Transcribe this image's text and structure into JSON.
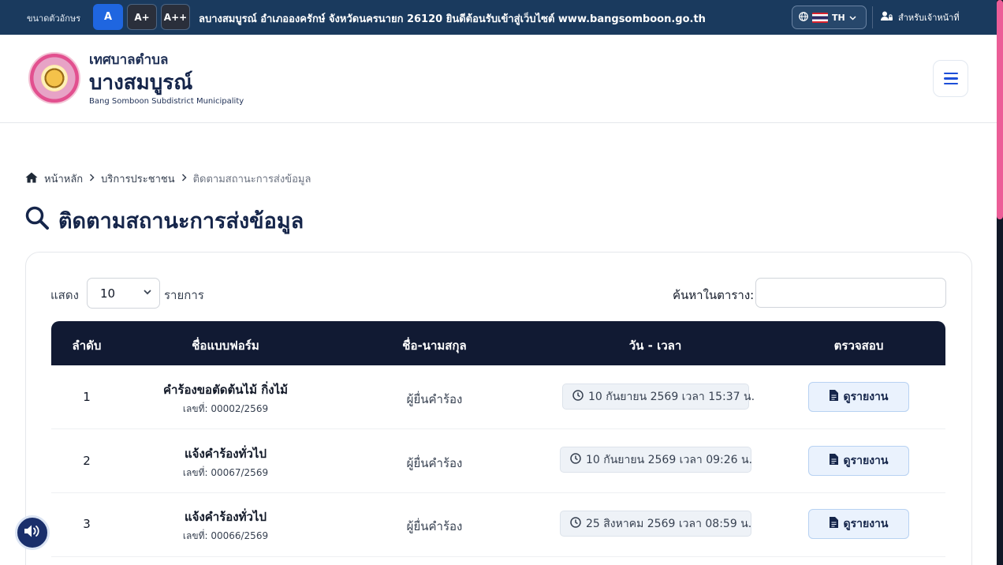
{
  "topbar": {
    "font_size_label": "ขนาดตัวอักษร",
    "font_buttons": [
      "A",
      "A+",
      "A++"
    ],
    "marquee": "ลบางสมบูรณ์ อำเภอองครักษ์ จังหวัดนครนายก 26120 ยินดีต้อนรับเข้าสู่เว็บไซต์ www.bangsomboon.go.th",
    "language": "TH",
    "staff_link": "สำหรับเจ้าหน้าที่"
  },
  "header": {
    "org_small": "เทศบาลตำบล",
    "org_big": "บางสมบูรณ์",
    "org_en": "Bang Somboon Subdistrict Municipality"
  },
  "breadcrumb": {
    "home": "หน้าหลัก",
    "section": "บริการประชาชน",
    "current": "ติดตามสถานะการส่งข้อมูล"
  },
  "page_title": "ติดตามสถานะการส่งข้อมูล",
  "table_controls": {
    "show_label": "แสดง",
    "page_size": "10",
    "items_label": "รายการ",
    "search_label": "ค้นหาในตาราง:",
    "search_value": ""
  },
  "table": {
    "headers": [
      "ลำดับ",
      "ชื่อแบบฟอร์ม",
      "ชื่อ-นามสกุล",
      "วัน - เวลา",
      "ตรวจสอบ"
    ],
    "rows": [
      {
        "no": "1",
        "form": "คำร้องขอตัดต้นไม้ กิ่งไม้",
        "ref": "เลขที่: 00002/2569",
        "name": "ผู้ยื่นคำร้อง",
        "datetime": "10 กันยายน 2569 เวลา 15:37 น.",
        "action": "ดูรายงาน"
      },
      {
        "no": "2",
        "form": "แจ้งคำร้องทั่วไป",
        "ref": "เลขที่: 00067/2569",
        "name": "ผู้ยื่นคำร้อง",
        "datetime": "10 กันยายน 2569 เวลา 09:26 น.",
        "action": "ดูรายงาน"
      },
      {
        "no": "3",
        "form": "แจ้งคำร้องทั่วไป",
        "ref": "เลขที่: 00066/2569",
        "name": "ผู้ยื่นคำร้อง",
        "datetime": "25 สิงหาคม 2569 เวลา 08:59 น.",
        "action": "ดูรายงาน"
      }
    ]
  },
  "colors": {
    "topbar": "#1a3a5e",
    "table_header": "#111a33",
    "accent": "#1f66e0",
    "scroll_thumb": "#ec5d97"
  }
}
